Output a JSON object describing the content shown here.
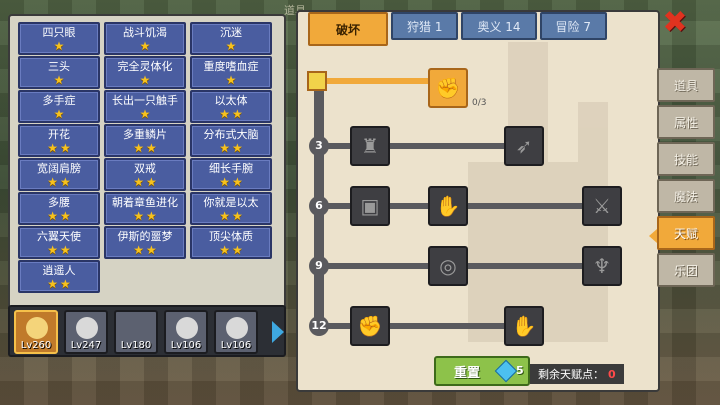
{
  "world": {
    "label": "道具"
  },
  "traits": [
    {
      "name": "四只眼",
      "stars": 1
    },
    {
      "name": "战斗饥渴",
      "stars": 1
    },
    {
      "name": "沉迷",
      "stars": 1
    },
    {
      "name": "三头",
      "stars": 1
    },
    {
      "name": "完全灵体化",
      "stars": 1
    },
    {
      "name": "重度嗜血症",
      "stars": 1
    },
    {
      "name": "多手症",
      "stars": 1
    },
    {
      "name": "长出一只触手",
      "stars": 1
    },
    {
      "name": "以太体",
      "stars": 2
    },
    {
      "name": "开花",
      "stars": 2
    },
    {
      "name": "多重鳞片",
      "stars": 2
    },
    {
      "name": "分布式大脑",
      "stars": 2
    },
    {
      "name": "宽阔肩膀",
      "stars": 2
    },
    {
      "name": "双戒",
      "stars": 2
    },
    {
      "name": "细长手腕",
      "stars": 2
    },
    {
      "name": "多腰",
      "stars": 2
    },
    {
      "name": "朝着章鱼进化",
      "stars": 2
    },
    {
      "name": "你就是以太",
      "stars": 2
    },
    {
      "name": "六翼天使",
      "stars": 2
    },
    {
      "name": "伊斯的噩梦",
      "stars": 2
    },
    {
      "name": "顶尖体质",
      "stars": 2
    },
    {
      "name": "逍遥人",
      "stars": 2
    }
  ],
  "party": [
    {
      "level": "Lv260",
      "selected": true
    },
    {
      "level": "Lv247",
      "selected": false
    },
    {
      "level": "Lv180",
      "selected": false,
      "empty": true
    },
    {
      "level": "Lv106",
      "selected": false
    },
    {
      "level": "Lv106",
      "selected": false
    }
  ],
  "tabs": [
    {
      "label": "破坏",
      "active": true
    },
    {
      "label": "狩猎 1",
      "active": false
    },
    {
      "label": "奥义 14",
      "active": false
    },
    {
      "label": "冒险 7",
      "active": false
    }
  ],
  "tree": {
    "top_node_count": "0/3",
    "rows": [
      {
        "level": "3",
        "nodes": [
          "muscle-icon",
          "arrow-strike-icon"
        ]
      },
      {
        "level": "6",
        "nodes": [
          "cards-icon",
          "fist-block-icon",
          "blade-icon"
        ]
      },
      {
        "level": "9",
        "nodes": [
          "vortex-icon",
          "demon-icon"
        ]
      },
      {
        "level": "12",
        "nodes": [
          "fist-icon",
          "gauntlet-icon"
        ]
      }
    ]
  },
  "reset": {
    "label": "重置",
    "cost": "5"
  },
  "remaining": {
    "label": "剩余天赋点：",
    "points": "0"
  },
  "side_menu": [
    {
      "label": "道具",
      "active": false
    },
    {
      "label": "属性",
      "active": false
    },
    {
      "label": "技能",
      "active": false
    },
    {
      "label": "魔法",
      "active": false
    },
    {
      "label": "天赋",
      "active": true
    },
    {
      "label": "乐团",
      "active": false
    }
  ],
  "close_label": "✖"
}
